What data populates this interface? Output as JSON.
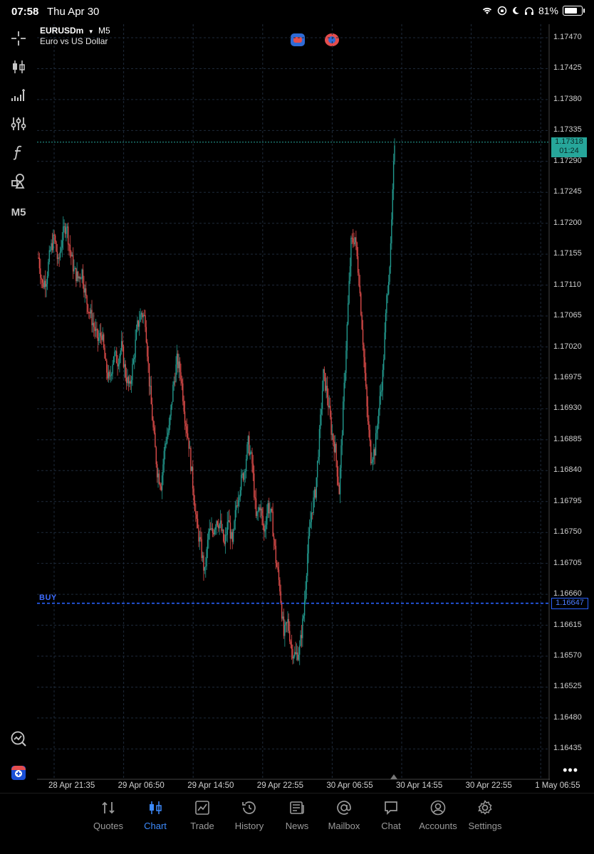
{
  "status_bar": {
    "time": "07:58",
    "date": "Thu Apr 30",
    "battery": "81%"
  },
  "symbol": {
    "name": "EURUSDm",
    "timeframe": "M5",
    "description": "Euro vs US Dollar",
    "dropdown_icon": "caret-down-icon"
  },
  "toolbar": {
    "timeframe_label": "M5",
    "icons": [
      "crosshair-icon",
      "candlestick-icon",
      "indicators-icon",
      "settings-sliders-icon",
      "function-icon",
      "objects-icon",
      "timeframe",
      "analytics-icon",
      "add-chart-icon"
    ]
  },
  "price_axis": {
    "labels": [
      "1.17470",
      "1.17425",
      "1.17380",
      "1.17335",
      "1.17290",
      "1.17245",
      "1.17200",
      "1.17155",
      "1.17110",
      "1.17065",
      "1.17020",
      "1.16975",
      "1.16930",
      "1.16885",
      "1.16840",
      "1.16795",
      "1.16750",
      "1.16705",
      "1.16660",
      "1.16615",
      "1.16570",
      "1.16525",
      "1.16480",
      "1.16435"
    ]
  },
  "current_price": {
    "value": "1.17318",
    "countdown": "01:24"
  },
  "buy_line": {
    "label": "BUY",
    "price": "1.16647"
  },
  "time_axis": {
    "labels": [
      "28 Apr 21:35",
      "29 Apr 06:50",
      "29 Apr 14:50",
      "29 Apr 22:55",
      "30 Apr 06:55",
      "30 Apr 14:55",
      "30 Apr 22:55",
      "1 May 06:55"
    ]
  },
  "chart_data": {
    "type": "line",
    "title": "EURUSDm M5",
    "ylim": [
      1.1641,
      1.1749
    ],
    "y_axis_ticks": [
      1.1747,
      1.17425,
      1.1738,
      1.17335,
      1.1729,
      1.17245,
      1.172,
      1.17155,
      1.1711,
      1.17065,
      1.1702,
      1.16975,
      1.1693,
      1.16885,
      1.1684,
      1.16795,
      1.1675,
      1.16705,
      1.1666,
      1.16615,
      1.1657,
      1.16525,
      1.1648,
      1.16435
    ],
    "x_categories": [
      "28 Apr 21:35",
      "29 Apr 06:50",
      "29 Apr 14:50",
      "29 Apr 22:55",
      "30 Apr 06:55",
      "30 Apr 14:55",
      "30 Apr 22:55",
      "1 May 06:55"
    ],
    "series": [
      {
        "values": [
          1.1715,
          1.1711,
          1.1712,
          1.1716,
          1.1718,
          1.1714,
          1.1718,
          1.172,
          1.1716,
          1.1713,
          1.1712,
          1.1713,
          1.1709,
          1.1707,
          1.1705,
          1.1703,
          1.1704,
          1.1699,
          1.1697,
          1.1701,
          1.17,
          1.1702,
          1.1698,
          1.1696,
          1.17,
          1.1705,
          1.1707,
          1.1706,
          1.1697,
          1.169,
          1.1684,
          1.1682,
          1.1688,
          1.169,
          1.1696,
          1.17,
          1.1698,
          1.1692,
          1.1688,
          1.1682,
          1.1676,
          1.1673,
          1.1669,
          1.1675,
          1.1675,
          1.1677,
          1.1676,
          1.1673,
          1.1677,
          1.1673,
          1.1679,
          1.1682,
          1.1684,
          1.1688,
          1.1685,
          1.1677,
          1.1679,
          1.1675,
          1.1679,
          1.1677,
          1.1671,
          1.1667,
          1.166,
          1.1662,
          1.1658,
          1.1657,
          1.1658,
          1.1663,
          1.1672,
          1.1678,
          1.1681,
          1.1689,
          1.1698,
          1.1695,
          1.169,
          1.1687,
          1.1681,
          1.1693,
          1.1705,
          1.1717,
          1.1718,
          1.1712,
          1.1703,
          1.1693,
          1.1686,
          1.1687,
          1.1693,
          1.1698,
          1.1709,
          1.1716,
          1.1732
        ]
      }
    ],
    "current_price": 1.17318,
    "buy_level": 1.16647,
    "grid": true,
    "up_color": "#26a69a",
    "down_color": "#ef5350"
  },
  "tabs": [
    {
      "label": "Quotes",
      "icon": "quotes-icon",
      "active": false
    },
    {
      "label": "Chart",
      "icon": "chart-candles-icon",
      "active": true
    },
    {
      "label": "Trade",
      "icon": "trade-icon",
      "active": false
    },
    {
      "label": "History",
      "icon": "history-icon",
      "active": false
    },
    {
      "label": "News",
      "icon": "news-icon",
      "active": false
    },
    {
      "label": "Mailbox",
      "icon": "mailbox-icon",
      "active": false
    },
    {
      "label": "Chat",
      "icon": "chat-icon",
      "active": false
    },
    {
      "label": "Accounts",
      "icon": "accounts-icon",
      "active": false
    },
    {
      "label": "Settings",
      "icon": "settings-gear-icon",
      "active": false
    }
  ],
  "colors": {
    "accent": "#3d8bfd",
    "bid_line": "#26a69a",
    "buy_line": "#2962ff",
    "grid": "#1e2a3a"
  }
}
